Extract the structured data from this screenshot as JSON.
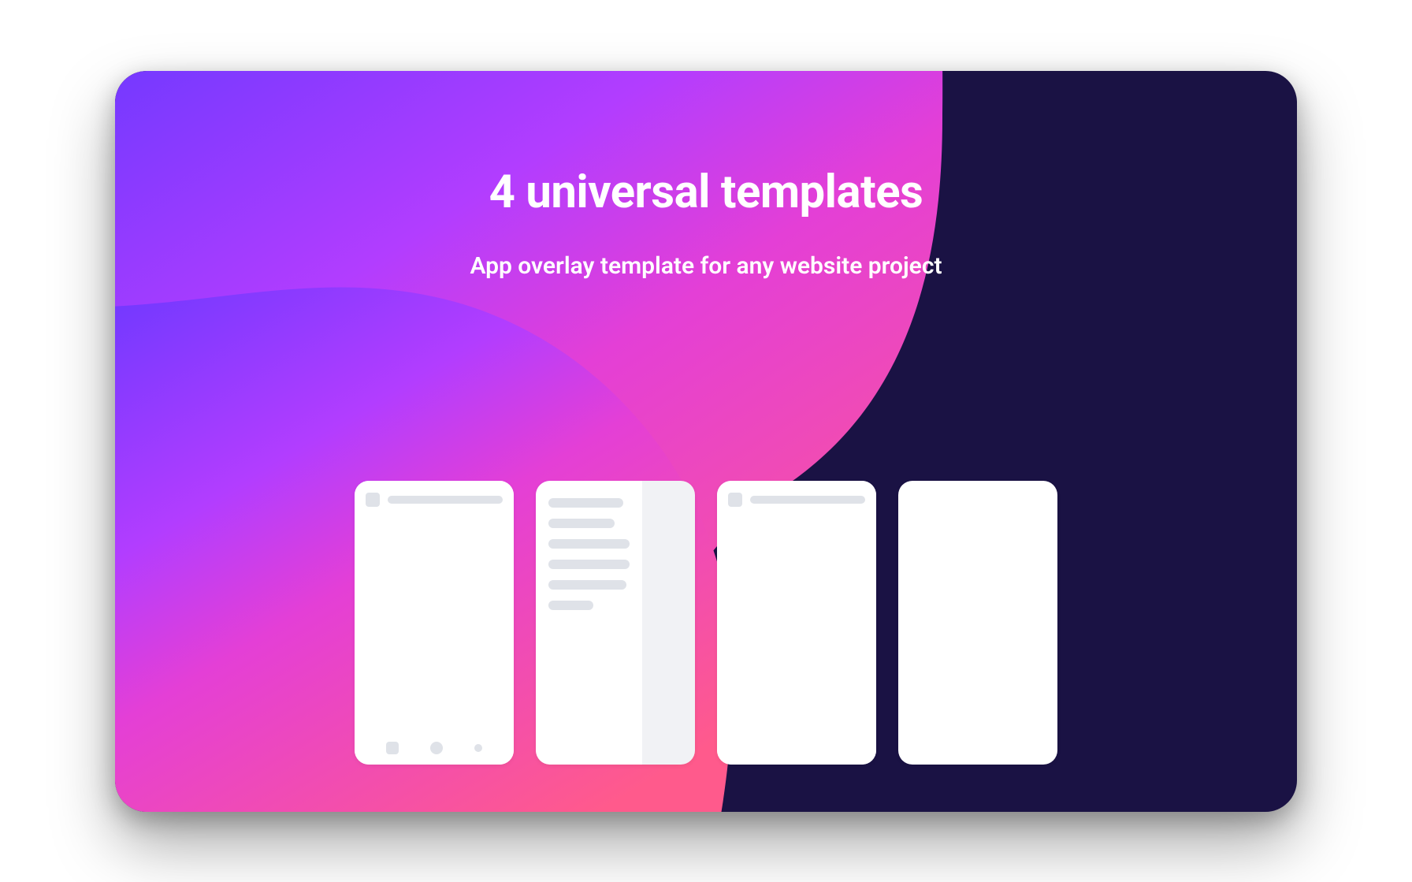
{
  "hero": {
    "title": "4 universal templates",
    "subtitle": "App overlay template for any website project"
  },
  "colors": {
    "bg": "#1a1244",
    "gradient_start": "#7b3cff",
    "gradient_mid": "#d73fe4",
    "gradient_end": "#ff5a8c"
  },
  "templates": [
    {
      "name": "header-footer-bars",
      "variant": "header+footer"
    },
    {
      "name": "drawer-menu",
      "variant": "side-drawer"
    },
    {
      "name": "header-only",
      "variant": "header"
    },
    {
      "name": "blank",
      "variant": "blank"
    }
  ]
}
